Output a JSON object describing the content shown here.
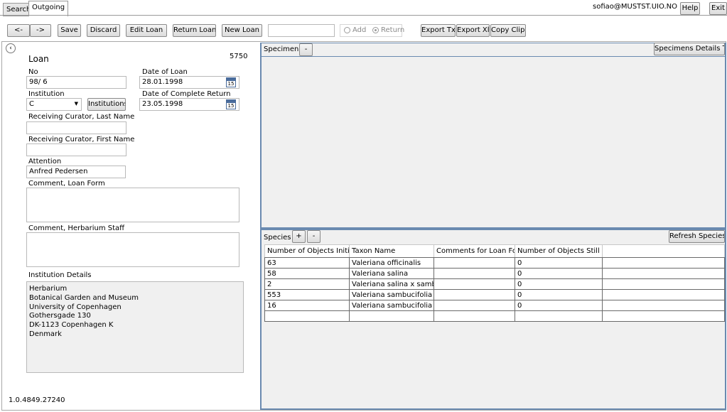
{
  "tabs": [
    {
      "label": "Search"
    },
    {
      "label": "Outgoing"
    }
  ],
  "header": {
    "user": "sofiao@MUSTST.UIO.NO",
    "help_label": "Help",
    "exit_label": "Exit"
  },
  "toolbar": {
    "back_label": "<-",
    "forward_label": "->",
    "save_label": "Save",
    "discard_label": "Discard",
    "edit_loan_label": "Edit Loan",
    "return_loan_label": "Return Loan",
    "new_loan_label": "New Loan",
    "scan_value": "",
    "add_label": "Add",
    "return_label": "Return",
    "export_txt_label": "Export Txt",
    "export_xls_label": "Export Xls",
    "copy_clip_label": "Copy Clip."
  },
  "loan": {
    "title": "Loan",
    "id": "5750",
    "no_label": "No",
    "no_value": "98/ 6",
    "date_of_loan_label": "Date of Loan",
    "date_of_loan_value": "28.01.1998",
    "institution_label": "Institution",
    "institution_value": "C",
    "institutions_button": "Institutions",
    "date_complete_return_label": "Date of Complete Return",
    "date_complete_return_value": "23.05.1998",
    "calendar_day": "15",
    "curator_last_label": "Receiving Curator, Last Name",
    "curator_last_value": "",
    "curator_first_label": "Receiving Curator, First Name",
    "curator_first_value": "",
    "attention_label": "Attention",
    "attention_value": "Anfred Pedersen",
    "comment_loan_form_label": "Comment, Loan Form",
    "comment_loan_form_value": "",
    "comment_staff_label": "Comment, Herbarium Staff",
    "comment_staff_value": "",
    "institution_details_label": "Institution Details",
    "institution_details_lines": [
      "Herbarium",
      "Botanical Garden and Museum",
      "University of Copenhagen",
      "Gothersgade 130",
      "DK-1123 Copenhagen K",
      "Denmark"
    ]
  },
  "version": "1.0.4849.27240",
  "specimen": {
    "label": "Specimen",
    "remove_label": "-",
    "details_txt_label": "Specimens Details Txt"
  },
  "species": {
    "label": "Species",
    "add_label": "+",
    "remove_label": "-",
    "refresh_label": "Refresh Species",
    "columns": [
      "Number of Objects Initially",
      "Taxon Name",
      "Comments for Loan Form",
      "Number of Objects Still Out",
      ""
    ],
    "rows": [
      [
        "63",
        "Valeriana officinalis",
        "",
        "0",
        ""
      ],
      [
        "58",
        "Valeriana salina",
        "",
        "0",
        ""
      ],
      [
        "2",
        "Valeriana salina x sambucif.",
        "",
        "0",
        ""
      ],
      [
        "553",
        "Valeriana sambucifolia",
        "",
        "0",
        ""
      ],
      [
        "16",
        "Valeriana sambucifolia div.",
        "",
        "0",
        ""
      ],
      [
        "",
        "",
        "",
        "",
        ""
      ]
    ]
  },
  "colors": {
    "panel_border": "#6a8ab0",
    "panel_bg": "#f0f0f0"
  }
}
